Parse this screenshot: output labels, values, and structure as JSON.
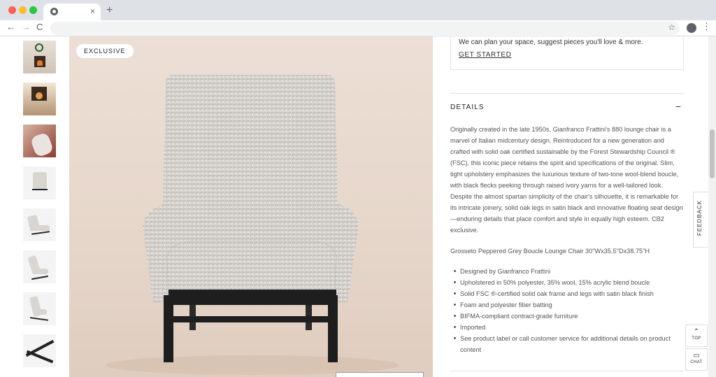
{
  "browser": {
    "tab_close": "×",
    "new_tab": "+",
    "back": "←",
    "forward": "→",
    "reload": "C",
    "bookmark_star": "☆",
    "menu": "⋮"
  },
  "gallery": {
    "badge": "EXCLUSIVE",
    "thumbnail_count": 8
  },
  "promo": {
    "text": "We can plan your space, suggest pieces you'll love & more.",
    "link": "GET STARTED"
  },
  "details": {
    "title": "DETAILS",
    "toggle": "−",
    "description": "Originally created in the late 1950s, Gianfranco Frattini's 880 lounge chair is a marvel of Italian midcentury design. Reintroduced for a new generation and crafted with solid oak certified sustainable by the Forest Stewardship Council ® (FSC), this iconic piece retains the spirit and specifications of the original. Slim, tight upholstery emphasizes the luxurious texture of two-tone wool-blend boucle, with black flecks peeking through raised ivory yarns for a well-tailored look. Despite the almost spartan simplicity of the chair's silhouette, it is remarkable for its intricate joinery, solid oak legs in satin black and innovative floating seat design—enduring details that place comfort and style in equally high esteem. CB2 exclusive.",
    "dimensions": "Grosseto Peppered Grey Boucle Lounge Chair 30\"Wx35.5\"Dx38.75\"H",
    "bullets": [
      "Designed by Gianfranco Frattini",
      "Upholstered in 50% polyester, 35% wool, 15% acrylic blend boucle",
      "Solid FSC ®-certified solid oak frame and legs with satin black finish",
      "Foam and polyester fiber batting",
      "BIFMA-compliant contract-grade furniture",
      "Imported",
      "See product label or call customer service for additional details on product content"
    ]
  },
  "side_tools": {
    "feedback": "FEEDBACK",
    "top_icon": "⌃",
    "top_label": "TOP",
    "chat_icon": "▭",
    "chat_label": "CHAT"
  },
  "colors": {
    "hero_background": "#e6d6ca",
    "boucle": "#d8d4cf",
    "legs": "#1e1e1e",
    "text": "#555555"
  }
}
